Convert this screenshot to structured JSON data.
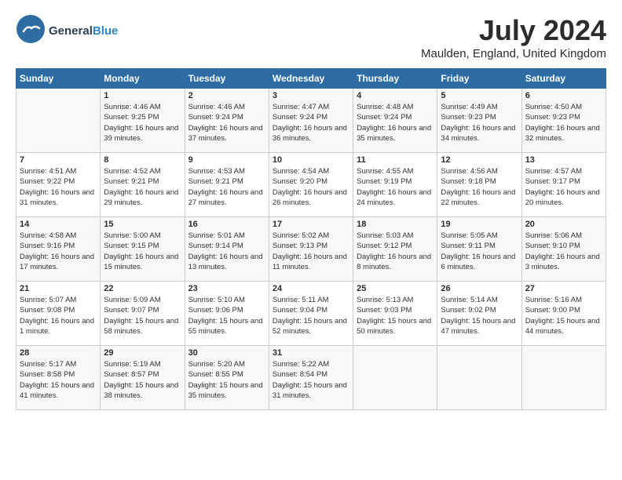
{
  "header": {
    "logo_general": "General",
    "logo_blue": "Blue",
    "month_year": "July 2024",
    "location": "Maulden, England, United Kingdom"
  },
  "days_of_week": [
    "Sunday",
    "Monday",
    "Tuesday",
    "Wednesday",
    "Thursday",
    "Friday",
    "Saturday"
  ],
  "weeks": [
    [
      {
        "day": "",
        "sunrise": "",
        "sunset": "",
        "daylight": ""
      },
      {
        "day": "1",
        "sunrise": "Sunrise: 4:46 AM",
        "sunset": "Sunset: 9:25 PM",
        "daylight": "Daylight: 16 hours and 39 minutes."
      },
      {
        "day": "2",
        "sunrise": "Sunrise: 4:46 AM",
        "sunset": "Sunset: 9:24 PM",
        "daylight": "Daylight: 16 hours and 37 minutes."
      },
      {
        "day": "3",
        "sunrise": "Sunrise: 4:47 AM",
        "sunset": "Sunset: 9:24 PM",
        "daylight": "Daylight: 16 hours and 36 minutes."
      },
      {
        "day": "4",
        "sunrise": "Sunrise: 4:48 AM",
        "sunset": "Sunset: 9:24 PM",
        "daylight": "Daylight: 16 hours and 35 minutes."
      },
      {
        "day": "5",
        "sunrise": "Sunrise: 4:49 AM",
        "sunset": "Sunset: 9:23 PM",
        "daylight": "Daylight: 16 hours and 34 minutes."
      },
      {
        "day": "6",
        "sunrise": "Sunrise: 4:50 AM",
        "sunset": "Sunset: 9:23 PM",
        "daylight": "Daylight: 16 hours and 32 minutes."
      }
    ],
    [
      {
        "day": "7",
        "sunrise": "Sunrise: 4:51 AM",
        "sunset": "Sunset: 9:22 PM",
        "daylight": "Daylight: 16 hours and 31 minutes."
      },
      {
        "day": "8",
        "sunrise": "Sunrise: 4:52 AM",
        "sunset": "Sunset: 9:21 PM",
        "daylight": "Daylight: 16 hours and 29 minutes."
      },
      {
        "day": "9",
        "sunrise": "Sunrise: 4:53 AM",
        "sunset": "Sunset: 9:21 PM",
        "daylight": "Daylight: 16 hours and 27 minutes."
      },
      {
        "day": "10",
        "sunrise": "Sunrise: 4:54 AM",
        "sunset": "Sunset: 9:20 PM",
        "daylight": "Daylight: 16 hours and 26 minutes."
      },
      {
        "day": "11",
        "sunrise": "Sunrise: 4:55 AM",
        "sunset": "Sunset: 9:19 PM",
        "daylight": "Daylight: 16 hours and 24 minutes."
      },
      {
        "day": "12",
        "sunrise": "Sunrise: 4:56 AM",
        "sunset": "Sunset: 9:18 PM",
        "daylight": "Daylight: 16 hours and 22 minutes."
      },
      {
        "day": "13",
        "sunrise": "Sunrise: 4:57 AM",
        "sunset": "Sunset: 9:17 PM",
        "daylight": "Daylight: 16 hours and 20 minutes."
      }
    ],
    [
      {
        "day": "14",
        "sunrise": "Sunrise: 4:58 AM",
        "sunset": "Sunset: 9:16 PM",
        "daylight": "Daylight: 16 hours and 17 minutes."
      },
      {
        "day": "15",
        "sunrise": "Sunrise: 5:00 AM",
        "sunset": "Sunset: 9:15 PM",
        "daylight": "Daylight: 16 hours and 15 minutes."
      },
      {
        "day": "16",
        "sunrise": "Sunrise: 5:01 AM",
        "sunset": "Sunset: 9:14 PM",
        "daylight": "Daylight: 16 hours and 13 minutes."
      },
      {
        "day": "17",
        "sunrise": "Sunrise: 5:02 AM",
        "sunset": "Sunset: 9:13 PM",
        "daylight": "Daylight: 16 hours and 11 minutes."
      },
      {
        "day": "18",
        "sunrise": "Sunrise: 5:03 AM",
        "sunset": "Sunset: 9:12 PM",
        "daylight": "Daylight: 16 hours and 8 minutes."
      },
      {
        "day": "19",
        "sunrise": "Sunrise: 5:05 AM",
        "sunset": "Sunset: 9:11 PM",
        "daylight": "Daylight: 16 hours and 6 minutes."
      },
      {
        "day": "20",
        "sunrise": "Sunrise: 5:06 AM",
        "sunset": "Sunset: 9:10 PM",
        "daylight": "Daylight: 16 hours and 3 minutes."
      }
    ],
    [
      {
        "day": "21",
        "sunrise": "Sunrise: 5:07 AM",
        "sunset": "Sunset: 9:08 PM",
        "daylight": "Daylight: 16 hours and 1 minute."
      },
      {
        "day": "22",
        "sunrise": "Sunrise: 5:09 AM",
        "sunset": "Sunset: 9:07 PM",
        "daylight": "Daylight: 15 hours and 58 minutes."
      },
      {
        "day": "23",
        "sunrise": "Sunrise: 5:10 AM",
        "sunset": "Sunset: 9:06 PM",
        "daylight": "Daylight: 15 hours and 55 minutes."
      },
      {
        "day": "24",
        "sunrise": "Sunrise: 5:11 AM",
        "sunset": "Sunset: 9:04 PM",
        "daylight": "Daylight: 15 hours and 52 minutes."
      },
      {
        "day": "25",
        "sunrise": "Sunrise: 5:13 AM",
        "sunset": "Sunset: 9:03 PM",
        "daylight": "Daylight: 15 hours and 50 minutes."
      },
      {
        "day": "26",
        "sunrise": "Sunrise: 5:14 AM",
        "sunset": "Sunset: 9:02 PM",
        "daylight": "Daylight: 15 hours and 47 minutes."
      },
      {
        "day": "27",
        "sunrise": "Sunrise: 5:16 AM",
        "sunset": "Sunset: 9:00 PM",
        "daylight": "Daylight: 15 hours and 44 minutes."
      }
    ],
    [
      {
        "day": "28",
        "sunrise": "Sunrise: 5:17 AM",
        "sunset": "Sunset: 8:58 PM",
        "daylight": "Daylight: 15 hours and 41 minutes."
      },
      {
        "day": "29",
        "sunrise": "Sunrise: 5:19 AM",
        "sunset": "Sunset: 8:57 PM",
        "daylight": "Daylight: 15 hours and 38 minutes."
      },
      {
        "day": "30",
        "sunrise": "Sunrise: 5:20 AM",
        "sunset": "Sunset: 8:55 PM",
        "daylight": "Daylight: 15 hours and 35 minutes."
      },
      {
        "day": "31",
        "sunrise": "Sunrise: 5:22 AM",
        "sunset": "Sunset: 8:54 PM",
        "daylight": "Daylight: 15 hours and 31 minutes."
      },
      {
        "day": "",
        "sunrise": "",
        "sunset": "",
        "daylight": ""
      },
      {
        "day": "",
        "sunrise": "",
        "sunset": "",
        "daylight": ""
      },
      {
        "day": "",
        "sunrise": "",
        "sunset": "",
        "daylight": ""
      }
    ]
  ]
}
